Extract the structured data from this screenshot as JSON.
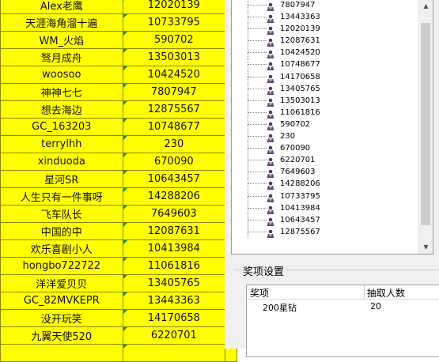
{
  "sheet": {
    "rows": [
      {
        "name": "Alex老鹰",
        "id": "12020139"
      },
      {
        "name": "天涯海角溜十遍",
        "id": "10733795"
      },
      {
        "name": "WM_火焰",
        "id": "590702"
      },
      {
        "name": "驽月成舟",
        "id": "13503013"
      },
      {
        "name": "woosoo",
        "id": "10424520"
      },
      {
        "name": "神神七七",
        "id": "7807947"
      },
      {
        "name": "想去海边",
        "id": "12875567"
      },
      {
        "name": "GC_163203",
        "id": "10748677"
      },
      {
        "name": "terrylhh",
        "id": "230"
      },
      {
        "name": "xinduoda",
        "id": "670090"
      },
      {
        "name": "星河SR",
        "id": "10643457"
      },
      {
        "name": "人生只有一件事呀",
        "id": "14288206"
      },
      {
        "name": "飞车队长",
        "id": "7649603"
      },
      {
        "name": "中国的中",
        "id": "12087631"
      },
      {
        "name": "欢乐喜剧小人",
        "id": "10413984"
      },
      {
        "name": "hongbo722722",
        "id": "11061816"
      },
      {
        "name": "洋洋爱贝贝",
        "id": "13405765"
      },
      {
        "name": "GC_82MVKEPR",
        "id": "13443363"
      },
      {
        "name": "没开玩笑",
        "id": "14170658"
      },
      {
        "name": "九翼天使520",
        "id": "6220701"
      },
      {
        "name": "",
        "id": ""
      }
    ]
  },
  "tree": {
    "icon": "person-icon",
    "items": [
      "7807947",
      "13443363",
      "12020139",
      "12087631",
      "10424520",
      "10748677",
      "14170658",
      "13405765",
      "13503013",
      "11061816",
      "590702",
      "230",
      "670090",
      "6220701",
      "7649603",
      "14288206",
      "10733795",
      "10413984",
      "10643457",
      "12875567"
    ]
  },
  "award": {
    "title": "奖项设置",
    "col_item": "奖项",
    "col_count": "抽取人数",
    "rows": [
      {
        "item": "200星钻",
        "count": "20"
      }
    ]
  }
}
